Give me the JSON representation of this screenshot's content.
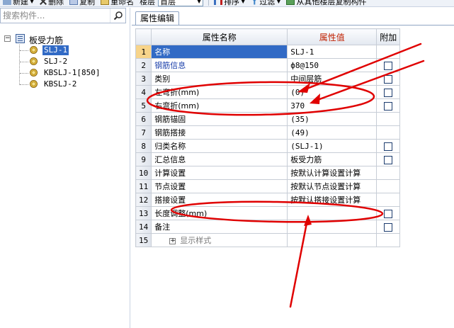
{
  "toolbar": {
    "new_label": "新建",
    "delete_label": "删除",
    "copy_label": "复制",
    "rename_label": "重命名",
    "floor_label": "楼层",
    "floor_value": "首层",
    "sort_label": "排序",
    "filter_label": "过滤",
    "copy_from_floor_label": "从其他楼层复制构件"
  },
  "search": {
    "placeholder": "搜索构件..."
  },
  "tree": {
    "root_label": "板受力筋",
    "expander": "⊟",
    "items": [
      {
        "label": "SLJ-1",
        "selected": true
      },
      {
        "label": "SLJ-2",
        "selected": false
      },
      {
        "label": "KBSLJ-1[850]",
        "selected": false
      },
      {
        "label": "KBSLJ-2",
        "selected": false
      }
    ]
  },
  "tab": {
    "label": "属性编辑"
  },
  "grid": {
    "headers": {
      "rownum": "",
      "name": "属性名称",
      "value": "属性值",
      "extra": "附加"
    },
    "rows": [
      {
        "num": "1",
        "name": "名称",
        "value": "SLJ-1",
        "checkbox": false
      },
      {
        "num": "2",
        "name": "钢筋信息",
        "value": "ф8@150",
        "checkbox": true
      },
      {
        "num": "3",
        "name": "类别",
        "value": "中间层筋",
        "checkbox": true
      },
      {
        "num": "4",
        "name": "左弯折(mm)",
        "value": "(0)",
        "checkbox": true
      },
      {
        "num": "5",
        "name": "右弯折(mm)",
        "value": "370",
        "checkbox": true
      },
      {
        "num": "6",
        "name": "钢筋锚固",
        "value": "(35)",
        "checkbox": false
      },
      {
        "num": "7",
        "name": "钢筋搭接",
        "value": "(49)",
        "checkbox": false
      },
      {
        "num": "8",
        "name": "归类名称",
        "value": "(SLJ-1)",
        "checkbox": true
      },
      {
        "num": "9",
        "name": "汇总信息",
        "value": "板受力筋",
        "checkbox": true
      },
      {
        "num": "10",
        "name": "计算设置",
        "value": "按默认计算设置计算",
        "checkbox": false
      },
      {
        "num": "11",
        "name": "节点设置",
        "value": "按默认节点设置计算",
        "checkbox": false
      },
      {
        "num": "12",
        "name": "搭接设置",
        "value": "按默认搭接设置计算",
        "checkbox": false
      },
      {
        "num": "13",
        "name": "长度调整(mm)",
        "value": "",
        "checkbox": true
      },
      {
        "num": "14",
        "name": "备注",
        "value": "",
        "checkbox": true
      },
      {
        "num": "15",
        "name": "显示样式",
        "value": "",
        "checkbox": false,
        "expander": "+"
      }
    ]
  },
  "colors": {
    "selection": "#316ac5",
    "annotation": "#e00000",
    "value_header": "#c02000",
    "link_blue": "#1a3faa"
  }
}
